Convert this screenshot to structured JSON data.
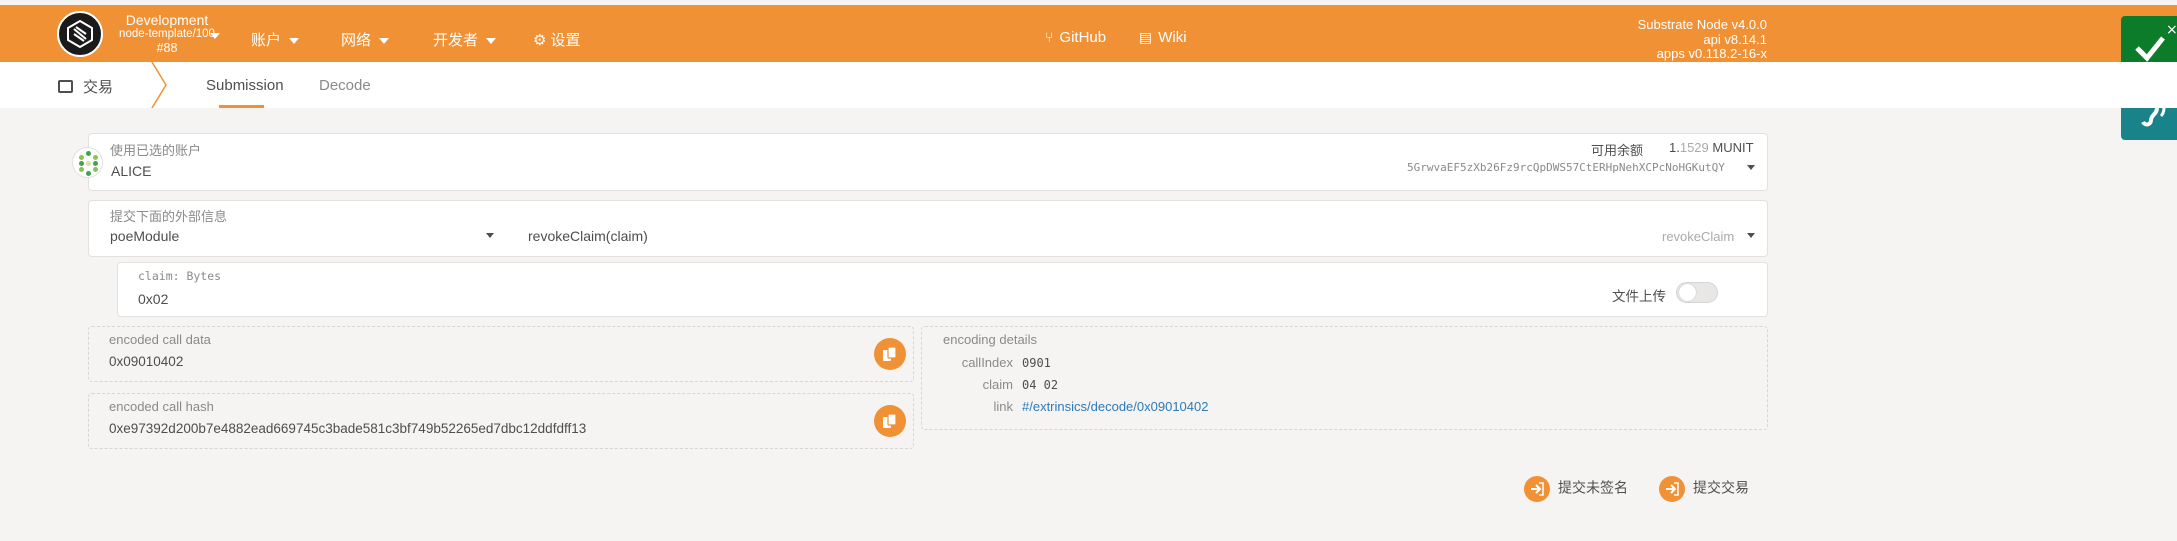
{
  "header": {
    "chain_name": "Development",
    "chain_runtime": "node-template/100",
    "chain_block": "#88",
    "menu": [
      {
        "label": "账户"
      },
      {
        "label": "网络"
      },
      {
        "label": "开发者"
      },
      {
        "label": "设置"
      }
    ],
    "links": {
      "github": "GitHub",
      "wiki": "Wiki"
    },
    "version": {
      "node": "Substrate Node v4.0.0",
      "api": "api v8.14.1",
      "apps": "apps v0.118.2-16-x"
    }
  },
  "subnav": {
    "section": "交易",
    "tabs": [
      {
        "label": "Submission",
        "active": true
      },
      {
        "label": "Decode",
        "active": false
      }
    ]
  },
  "account": {
    "label": "使用已选的账户",
    "name": "ALICE",
    "balance_label": "可用余额",
    "balance_int": "1.",
    "balance_frac": "1529",
    "balance_unit": "MUNIT",
    "address": "5GrwvaEF5zXb26Fz9rcQpDWS57CtERHpNehXCPcNoHGKutQY"
  },
  "extrinsic": {
    "label": "提交下面的外部信息",
    "module": "poeModule",
    "call": "revokeClaim(claim)",
    "call_short": "revokeClaim"
  },
  "param": {
    "label": "claim: Bytes",
    "value": "0x02",
    "file_upload_label": "文件上传"
  },
  "encoded": {
    "call_data_label": "encoded call data",
    "call_data": "0x09010402",
    "call_hash_label": "encoded call hash",
    "call_hash": "0xe97392d200b7e4882ead669745c3bade581c3bf749b52265ed7dbc12ddfdff13"
  },
  "details": {
    "title": "encoding details",
    "rows": [
      {
        "key": "callIndex",
        "value": "0901"
      },
      {
        "key": "claim",
        "value": "04 02"
      },
      {
        "key": "link",
        "value": "#/extrinsics/decode/0x09010402"
      }
    ]
  },
  "actions": {
    "unsigned": "提交未签名",
    "submit": "提交交易"
  },
  "colors": {
    "accent": "#f19135",
    "link": "#2e7bb8",
    "side_green": "#0d7c2a",
    "side_teal": "#188489"
  }
}
